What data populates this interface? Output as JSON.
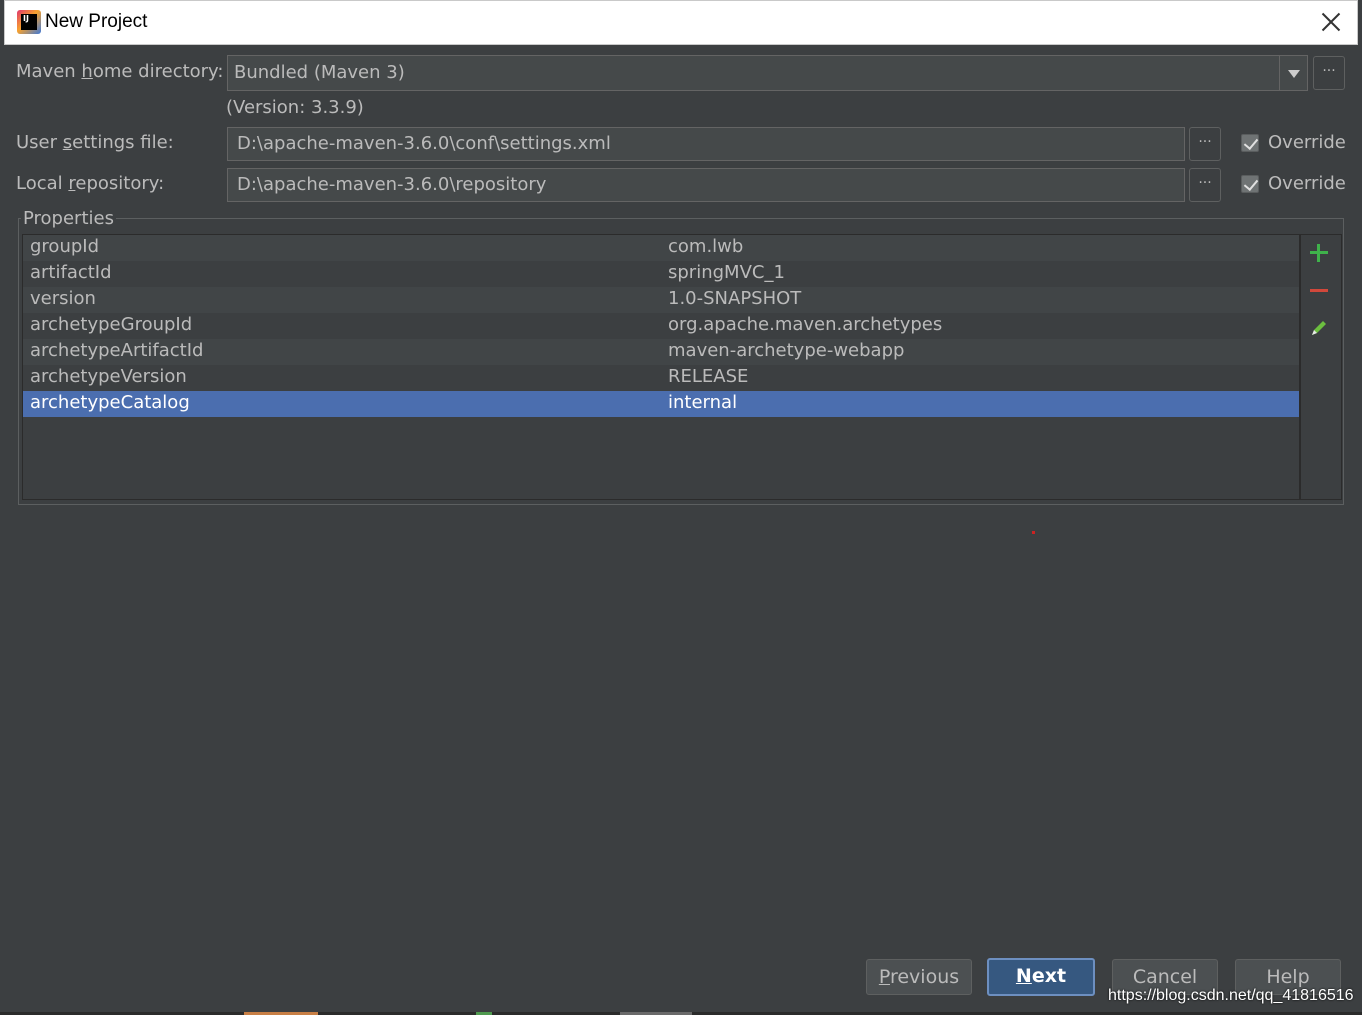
{
  "window": {
    "title": "New Project"
  },
  "maven_home": {
    "label_pre": "Maven ",
    "label_mn": "h",
    "label_post": "ome directory:",
    "value": "Bundled (Maven 3)",
    "version": "(Version: 3.3.9)"
  },
  "user_settings": {
    "label_pre": "User ",
    "label_mn": "s",
    "label_post": "ettings file:",
    "value": "D:\\apache-maven-3.6.0\\conf\\settings.xml",
    "override_label": "Override",
    "override_checked": true
  },
  "local_repo": {
    "label_pre": "Local ",
    "label_mn": "r",
    "label_post": "epository:",
    "value": "D:\\apache-maven-3.6.0\\repository",
    "override_label": "Override",
    "override_checked": true
  },
  "browse_label": "···",
  "properties": {
    "title": "Properties",
    "rows": [
      {
        "key": "groupId",
        "value": "com.lwb"
      },
      {
        "key": "artifactId",
        "value": "springMVC_1"
      },
      {
        "key": "version",
        "value": "1.0-SNAPSHOT"
      },
      {
        "key": "archetypeGroupId",
        "value": "org.apache.maven.archetypes"
      },
      {
        "key": "archetypeArtifactId",
        "value": "maven-archetype-webapp"
      },
      {
        "key": "archetypeVersion",
        "value": "RELEASE"
      },
      {
        "key": "archetypeCatalog",
        "value": "internal"
      }
    ],
    "selected_index": 6
  },
  "buttons": {
    "previous_mn": "P",
    "previous_rest": "revious",
    "next_mn": "N",
    "next_rest": "ext",
    "cancel": "Cancel",
    "help": "Help"
  },
  "watermark": "https://blog.csdn.net/qq_41816516",
  "colors": {
    "background": "#3c3f41",
    "selection": "#4b6eaf",
    "add_icon": "#3fb24b",
    "remove_icon": "#d1483b",
    "default_button": "#365880"
  }
}
